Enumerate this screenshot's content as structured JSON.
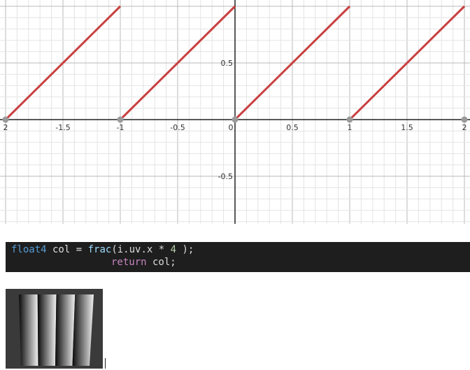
{
  "chart_data": {
    "type": "line",
    "title": "",
    "xlabel": "",
    "ylabel": "",
    "xlim": [
      -2,
      2
    ],
    "ylim": [
      -0.9,
      1
    ],
    "grid": true,
    "x_ticks": [
      {
        "value": -2,
        "label": "2"
      },
      {
        "value": -1.5,
        "label": "-1.5"
      },
      {
        "value": -1,
        "label": "-1"
      },
      {
        "value": -0.5,
        "label": "-0.5"
      },
      {
        "value": 0,
        "label": "0"
      },
      {
        "value": 0.5,
        "label": "0.5"
      },
      {
        "value": 1,
        "label": "1"
      },
      {
        "value": 1.5,
        "label": "1.5"
      },
      {
        "value": 2,
        "label": "2"
      }
    ],
    "y_ticks": [
      {
        "value": 0.5,
        "label": "0.5"
      },
      {
        "value": -0.5,
        "label": "-0.5"
      }
    ],
    "series": [
      {
        "color": "#c94040",
        "segments": [
          [
            [
              -2,
              0
            ],
            [
              -1,
              1
            ]
          ],
          [
            [
              -1,
              0
            ],
            [
              0,
              1
            ]
          ],
          [
            [
              0,
              0
            ],
            [
              1,
              1
            ]
          ],
          [
            [
              1,
              0
            ],
            [
              2,
              1
            ]
          ]
        ]
      }
    ],
    "points": [
      {
        "x": -2,
        "y": 0
      },
      {
        "x": -1,
        "y": 0
      },
      {
        "x": 0,
        "y": 0
      },
      {
        "x": 1,
        "y": 0
      },
      {
        "x": 2,
        "y": 0
      }
    ],
    "point_color": "#9a9a9a"
  },
  "code": {
    "line1": {
      "type": "float4",
      "decl": " col = ",
      "func": "frac",
      "args": "(i.uv.x * ",
      "num": "4",
      "tail": " );"
    },
    "line2": {
      "keyword": "return",
      "rest": " col;"
    }
  },
  "preview": {
    "background": "#3a3a3a",
    "stripes": 4
  }
}
